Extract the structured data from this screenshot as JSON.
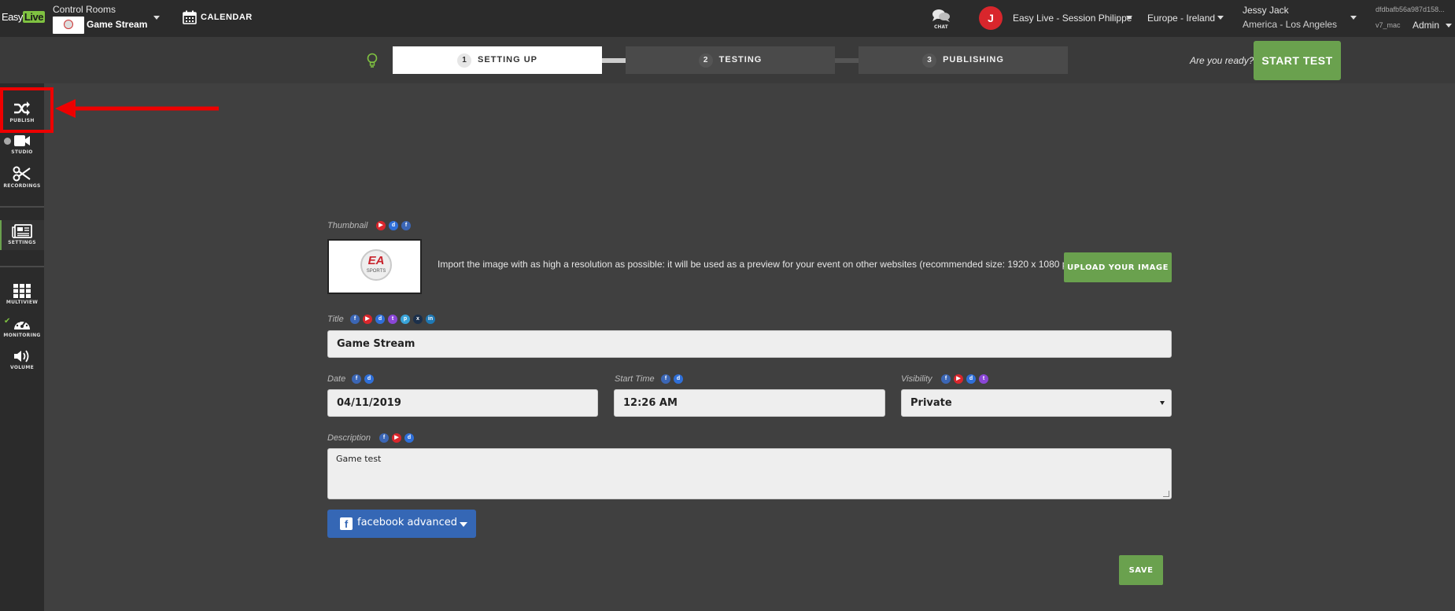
{
  "header": {
    "logo_text_easy": "Easy",
    "logo_text_live": "Live",
    "control_rooms_label": "Control Rooms",
    "control_room_name": "Game Stream",
    "calendar_label": "CALENDAR",
    "chat_label": "CHAT",
    "avatar_initial": "J",
    "session_name": "Easy Live - Session Philippe",
    "region": "Europe - Ireland",
    "user_name": "Jessy Jack",
    "user_timezone": "America - Los Angeles",
    "instance_hash": "dfdbafb56a987d158...",
    "version": "v7_mac",
    "role": "Admin"
  },
  "steps": [
    {
      "num": "1",
      "label": "SETTING UP",
      "active": true
    },
    {
      "num": "2",
      "label": "TESTING",
      "active": false
    },
    {
      "num": "3",
      "label": "PUBLISHING",
      "active": false
    }
  ],
  "ready_text": "Are you ready?",
  "start_test_label": "START TEST",
  "sidebar": {
    "items": [
      {
        "label": "PUBLISH",
        "icon": "shuffle-icon"
      },
      {
        "label": "STUDIO",
        "icon": "video-camera-icon"
      },
      {
        "label": "RECORDINGS",
        "icon": "scissors-icon"
      },
      {
        "label": "SETTINGS",
        "icon": "newspaper-icon"
      },
      {
        "label": "MULTIVIEW",
        "icon": "grid-icon"
      },
      {
        "label": "MONITORING",
        "icon": "gauge-icon"
      },
      {
        "label": "VOLUME",
        "icon": "speaker-icon"
      }
    ]
  },
  "form": {
    "thumbnail_label": "Thumbnail",
    "thumbnail_image_text": "EA",
    "thumbnail_image_subtext": "SPORTS",
    "thumbnail_help": "Import the image with as high a resolution as possible: it will be used as a preview for your event on other websites (recommended size: 1920 x 1080 pixels).",
    "upload_label": "UPLOAD YOUR IMAGE",
    "title_label": "Title",
    "title_value": "Game Stream",
    "date_label": "Date",
    "date_value": "04/11/2019",
    "start_time_label": "Start Time",
    "start_time_value": "12:26 AM",
    "visibility_label": "Visibility",
    "visibility_value": "Private",
    "description_label": "Description",
    "description_value": "Game test",
    "facebook_advanced_label": "facebook advanced",
    "save_label": "SAVE"
  },
  "colors": {
    "accent_green": "#6aa14e",
    "facebook_blue": "#3567b5",
    "highlight_red": "#e00000"
  }
}
